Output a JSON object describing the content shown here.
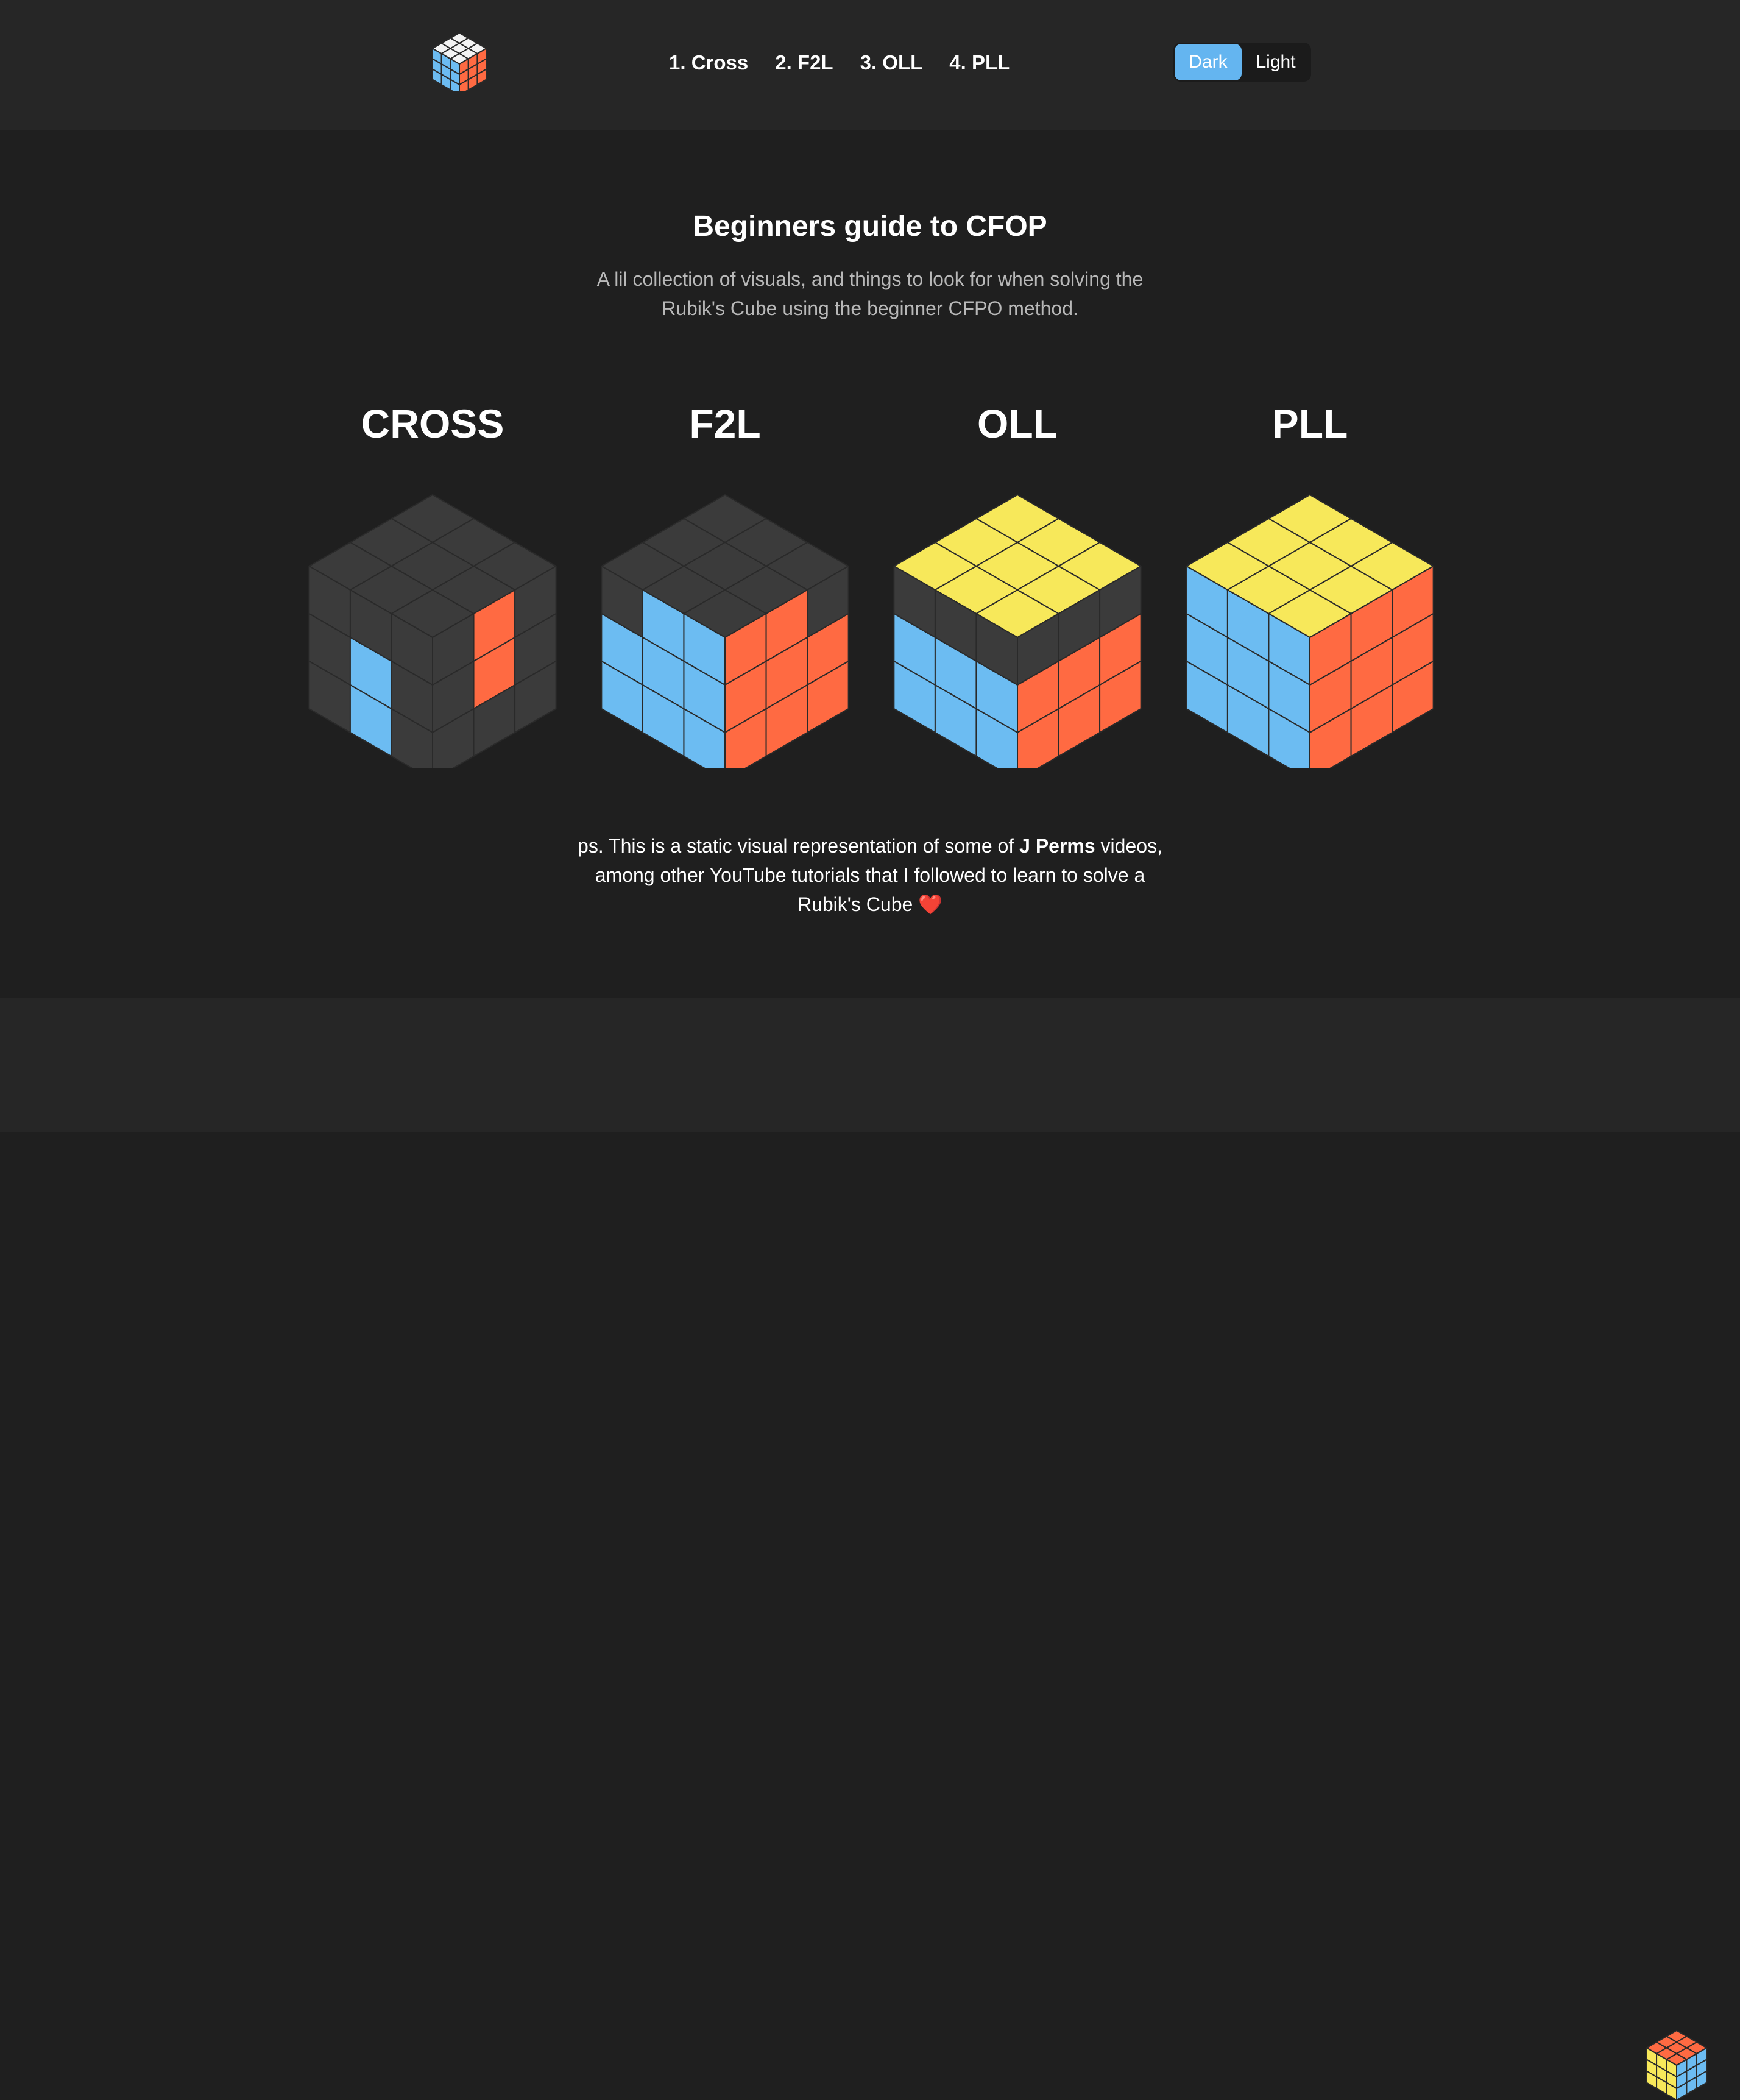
{
  "nav": {
    "links": [
      {
        "label": "1. Cross"
      },
      {
        "label": "2. F2L"
      },
      {
        "label": "3. OLL"
      },
      {
        "label": "4. PLL"
      }
    ]
  },
  "theme": {
    "dark_label": "Dark",
    "light_label": "Light",
    "selected": "Dark"
  },
  "hero": {
    "title": "Beginners guide to CFOP",
    "subtitle": "A lil collection of visuals, and things to look for when solving the Rubik's Cube using the beginner CFPO method."
  },
  "steps": [
    {
      "label": "CROSS"
    },
    {
      "label": "F2L"
    },
    {
      "label": "OLL"
    },
    {
      "label": "PLL"
    }
  ],
  "note": {
    "prefix": "ps. This is a static visual representation of some of ",
    "author": "J Perms",
    "suffix": " videos, among other YouTube tutorials that I followed to learn to solve a Rubik's Cube ❤️"
  },
  "colors": {
    "accent": "#64b5f0",
    "blue": "#6cbcf2",
    "orange": "#ff6a42",
    "yellow": "#f7e85a",
    "white": "#f3f3f3",
    "dark": "#3b3b3b"
  },
  "cubes": [
    {
      "name": "cross",
      "top": [
        "D",
        "D",
        "D",
        "D",
        "D",
        "D",
        "D",
        "D",
        "D"
      ],
      "left": [
        "D",
        "D",
        "D",
        "D",
        "B",
        "D",
        "D",
        "B",
        "D"
      ],
      "right": [
        "D",
        "O",
        "D",
        "D",
        "O",
        "D",
        "D",
        "D",
        "D"
      ],
      "bottom_cross": true
    },
    {
      "name": "f2l",
      "top": [
        "D",
        "D",
        "D",
        "D",
        "D",
        "D",
        "D",
        "D",
        "D"
      ],
      "left": [
        "D",
        "B",
        "B",
        "B",
        "B",
        "B",
        "B",
        "B",
        "B"
      ],
      "right": [
        "O",
        "O",
        "D",
        "O",
        "O",
        "O",
        "O",
        "O",
        "O"
      ],
      "bottom_white": true
    },
    {
      "name": "oll",
      "top": [
        "Y",
        "Y",
        "Y",
        "Y",
        "Y",
        "Y",
        "Y",
        "Y",
        "Y"
      ],
      "left": [
        "D",
        "D",
        "D",
        "B",
        "B",
        "B",
        "B",
        "B",
        "B"
      ],
      "right": [
        "D",
        "D",
        "D",
        "O",
        "O",
        "O",
        "O",
        "O",
        "O"
      ]
    },
    {
      "name": "pll",
      "top": [
        "Y",
        "Y",
        "Y",
        "Y",
        "Y",
        "Y",
        "Y",
        "Y",
        "Y"
      ],
      "left": [
        "B",
        "B",
        "B",
        "B",
        "B",
        "B",
        "B",
        "B",
        "B"
      ],
      "right": [
        "O",
        "O",
        "O",
        "O",
        "O",
        "O",
        "O",
        "O",
        "O"
      ]
    }
  ]
}
